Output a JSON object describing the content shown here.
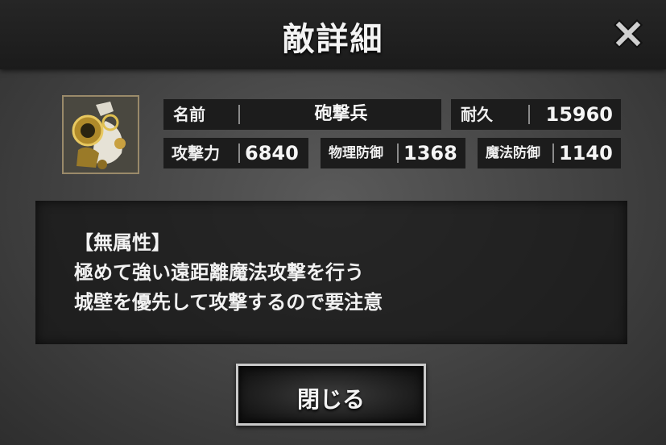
{
  "header": {
    "title": "敵詳細"
  },
  "enemy": {
    "name_label": "名前",
    "name": "砲撃兵",
    "durability_label": "耐久",
    "durability": "15960",
    "attack_label": "攻撃力",
    "attack": "6840",
    "phys_def_label": "物理防御",
    "phys_def": "1368",
    "magic_def_label": "魔法防御",
    "magic_def": "1140"
  },
  "description": {
    "lines": [
      "【無属性】",
      "極めて強い遠距離魔法攻撃を行う",
      "城壁を優先して攻撃するので要注意"
    ]
  },
  "footer": {
    "close_label": "閉じる"
  },
  "icons": {
    "close": "close-x-icon",
    "portrait": "cannon-soldier-portrait"
  }
}
